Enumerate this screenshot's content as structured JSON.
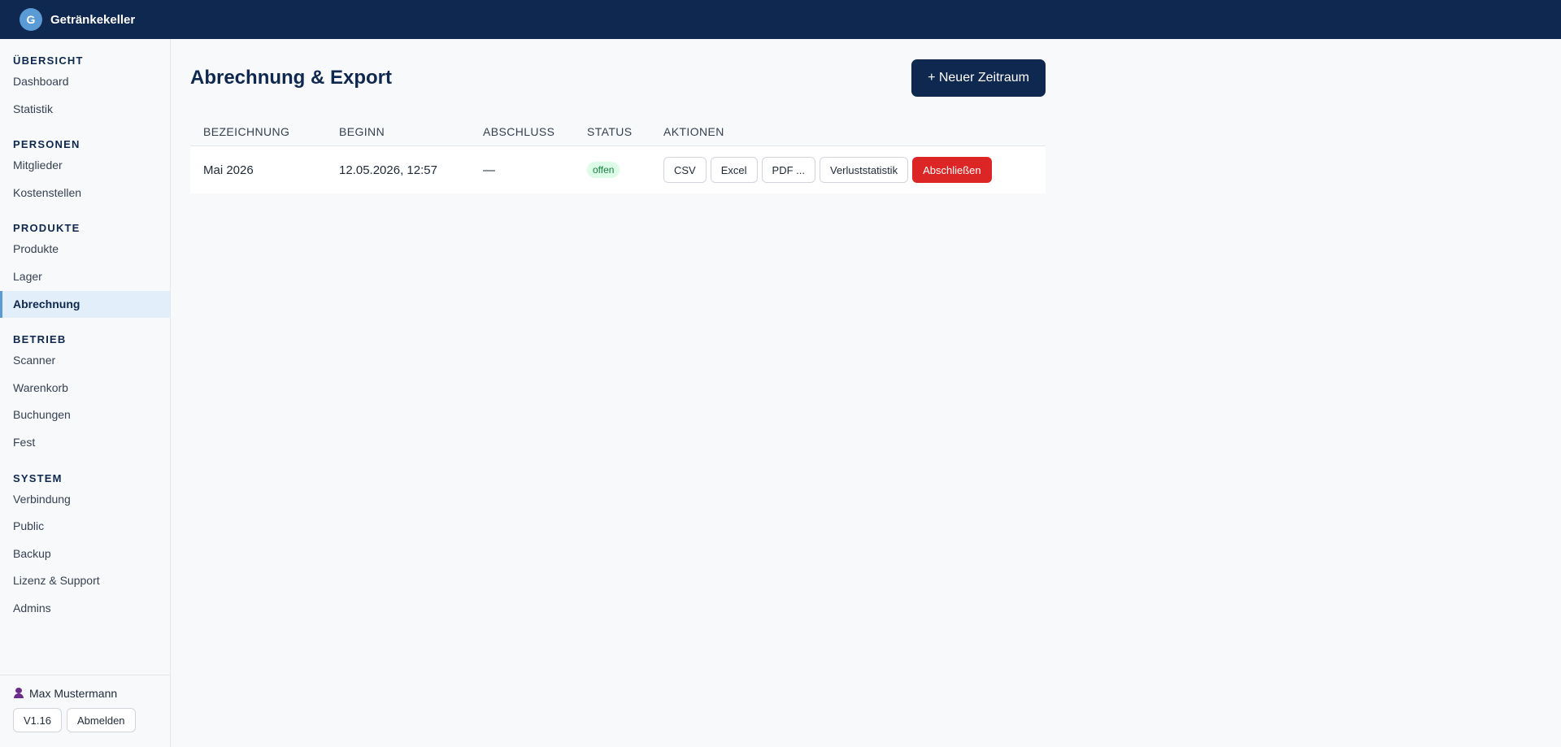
{
  "app": {
    "logo_letter": "G",
    "name": "Getränkekeller"
  },
  "sidebar": {
    "groups": [
      {
        "heading": "ÜBERSICHT",
        "items": [
          "Dashboard",
          "Statistik"
        ]
      },
      {
        "heading": "PERSONEN",
        "items": [
          "Mitglieder",
          "Kostenstellen"
        ]
      },
      {
        "heading": "PRODUKTE",
        "items": [
          "Produkte",
          "Lager",
          "Abrechnung"
        ]
      },
      {
        "heading": "BETRIEB",
        "items": [
          "Scanner",
          "Warenkorb",
          "Buchungen",
          "Fest"
        ]
      },
      {
        "heading": "SYSTEM",
        "items": [
          "Verbindung",
          "Public",
          "Backup",
          "Lizenz & Support",
          "Admins"
        ]
      }
    ],
    "active_item": "Abrechnung",
    "user_name": "Max Mustermann",
    "version_label": "V1.16",
    "logout_label": "Abmelden"
  },
  "page": {
    "title": "Abrechnung & Export",
    "new_period_label": "+ Neuer Zeitraum"
  },
  "table": {
    "columns": [
      "BEZEICHNUNG",
      "BEGINN",
      "ABSCHLUSS",
      "STATUS",
      "AKTIONEN"
    ],
    "rows": [
      {
        "name": "Mai 2026",
        "start": "12.05.2026, 12:57",
        "end": "—",
        "status": "offen",
        "actions": {
          "csv": "CSV",
          "excel": "Excel",
          "pdf": "PDF ...",
          "loss_stats": "Verluststatistik",
          "close": "Abschließen"
        }
      }
    ]
  },
  "colors": {
    "topbar": "#0f2850",
    "accent": "#5b9bd5",
    "danger": "#dc2626",
    "status_open": "#15803d"
  }
}
